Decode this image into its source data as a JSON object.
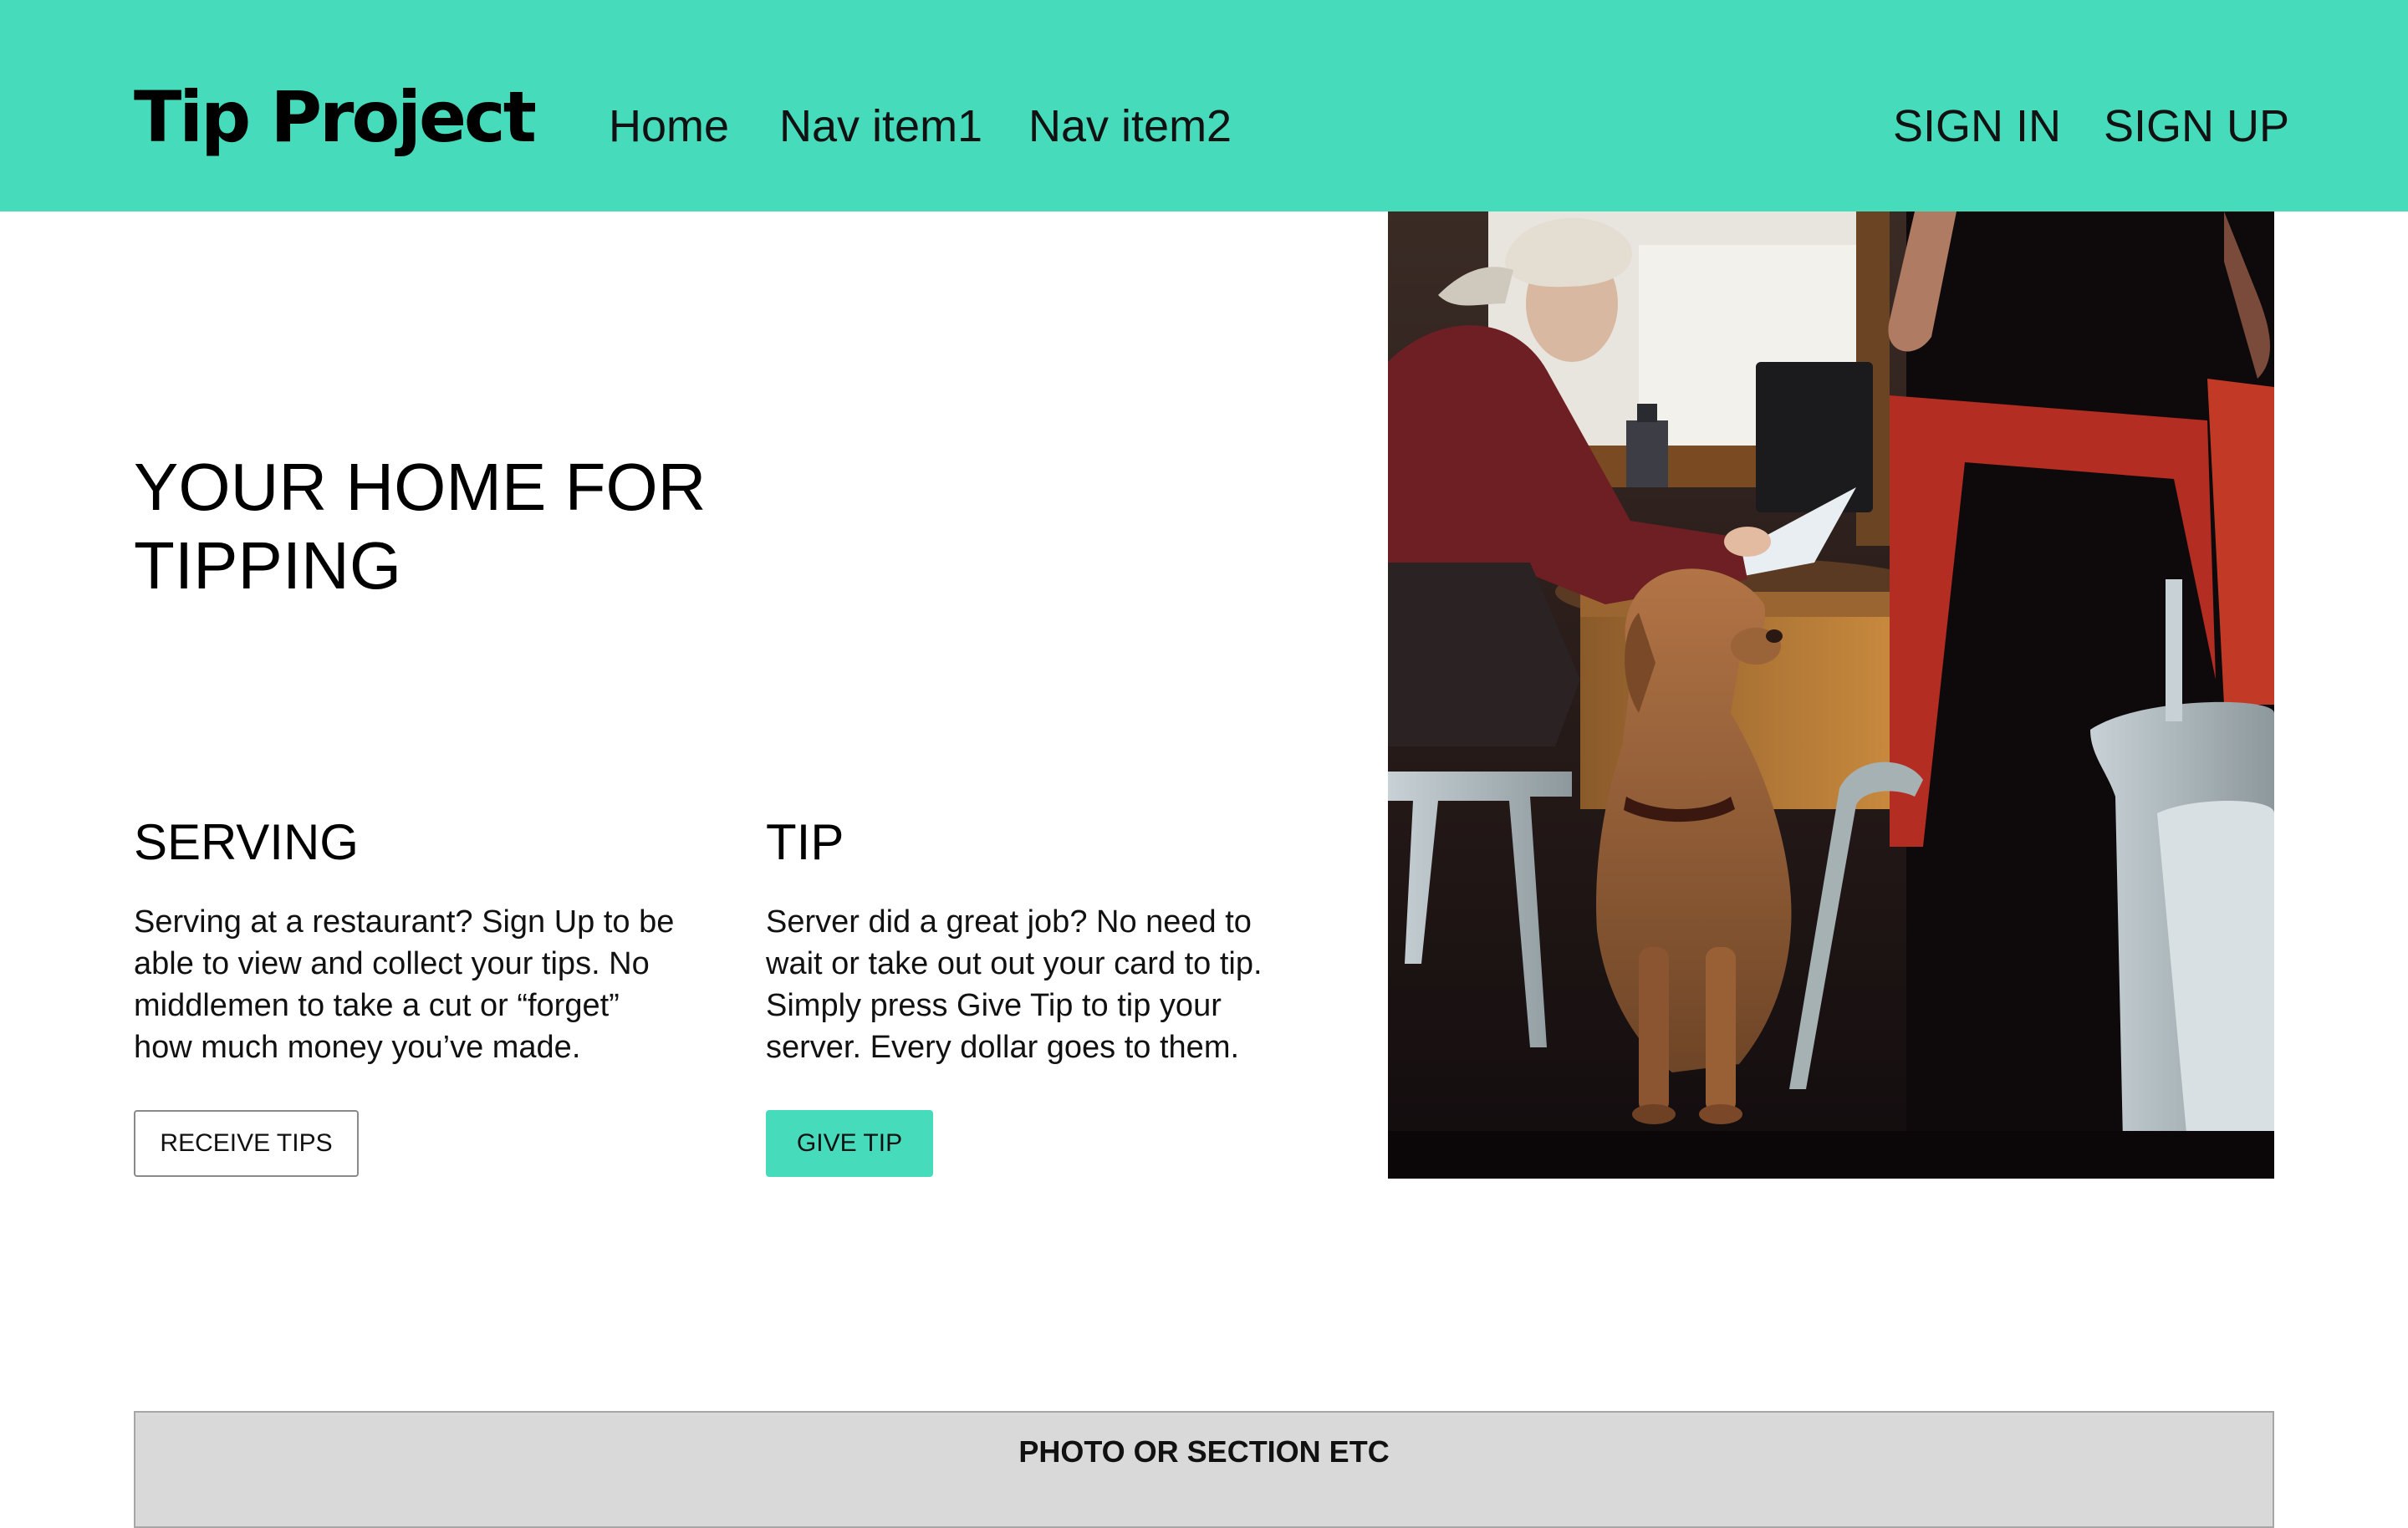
{
  "header": {
    "brand": "Tip Project",
    "nav": [
      "Home",
      "Nav item1",
      "Nav item2"
    ],
    "sign_in": "SIGN IN",
    "sign_up": "SIGN UP",
    "background_color": "#45dbbb"
  },
  "hero": {
    "title": "YOUR HOME FOR TIPPING"
  },
  "serving": {
    "title": "SERVING",
    "text": "Serving at a restaurant? Sign Up to be able to view and collect your tips. No middlemen to take a cut  or “forget” how much money you’ve made.",
    "button": "RECEIVE TIPS"
  },
  "tip": {
    "title": "TIP",
    "text": "Server did a great job? No need to wait or take out  out your card to tip. Simply press Give Tip to tip your server. Every dollar goes to them.",
    "button": "GIVE TIP",
    "button_color": "#45dbbb"
  },
  "footer": {
    "label": "PHOTO OR SECTION ETC"
  }
}
